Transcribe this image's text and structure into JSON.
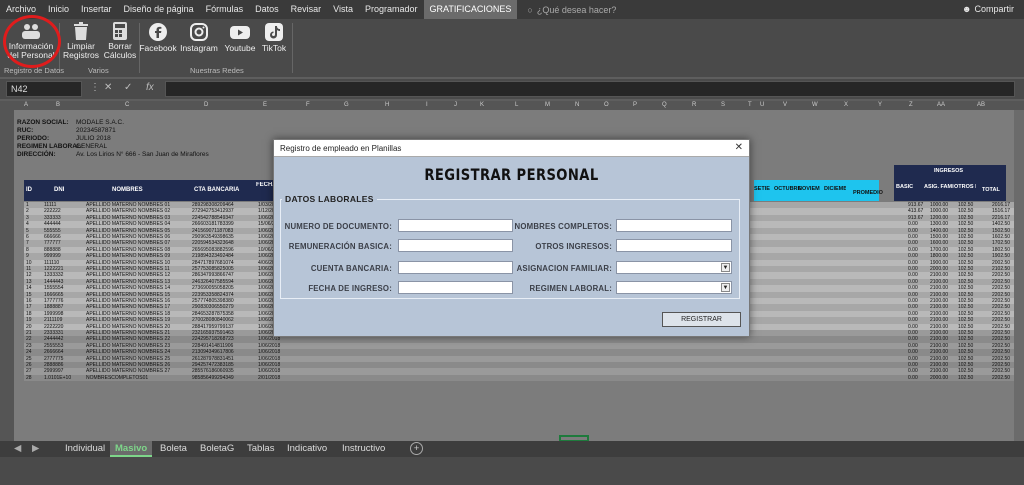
{
  "menu": {
    "tabs": [
      "Archivo",
      "Inicio",
      "Insertar",
      "Diseño de página",
      "Fórmulas",
      "Datos",
      "Revisar",
      "Vista",
      "Programador",
      "GRATIFICACIONES"
    ],
    "tell_me": "¿Qué desea hacer?",
    "share": "Compartir"
  },
  "ribbon": {
    "info_label": "Información del Personal",
    "clear_label": "Limpiar Registros",
    "delete_label": "Borrar Cálculos",
    "facebook": "Facebook",
    "instagram": "Instagram",
    "youtube": "Youtube",
    "tiktok": "TikTok",
    "group_data": "Registro de Datos",
    "group_misc": "Varios",
    "group_social": "Nuestras Redes"
  },
  "formula_bar": {
    "name_box": "N42",
    "fx": "fx",
    "content": ""
  },
  "sheet_info": {
    "labels": [
      "RAZON SOCIAL:",
      "RUC:",
      "PERIODO:",
      "REGIMEN LABORAL:",
      "DIRECCIÓN:"
    ],
    "values": [
      "MODALE S.A.C.",
      "20234587871",
      "JULIO 2018",
      "GENERAL",
      "Av. Los Lirios N° 666 - San Juan de Miraflores"
    ]
  },
  "table": {
    "headers": [
      "ID",
      "DNI",
      "NOMBRES",
      "CTA BANCARIA",
      "FECHA DE INGRESO"
    ],
    "right_headers": [
      "SETIEMBRE",
      "OCTUBRE",
      "NOVIEMBRE",
      "DICIEMBRE",
      "PROMEDIO",
      "BASIC",
      "ASIG. FAMI",
      "OTROS ING.",
      "TOTAL"
    ],
    "ingresos": "INGRESOS",
    "rows": [
      [
        "1",
        "11111",
        "APELLIDO MATERNO NOMBRES 01",
        "289298308209464",
        "1/03/2019",
        "913.67",
        "1000.00",
        "102.50",
        "2016.17"
      ],
      [
        "2",
        "222222",
        "APELLIDO MATERNO NOMBRES 02",
        "272942753412937",
        "1/12/2018",
        "413.67",
        "1000.00",
        "102.50",
        "1516.17"
      ],
      [
        "3",
        "333333",
        "APELLIDO MATERNO NOMBRES 03",
        "224542788549347",
        "1/06/2018",
        "913.67",
        "1200.00",
        "102.50",
        "2216.17"
      ],
      [
        "4",
        "444444",
        "APELLIDO MATERNO NOMBRES 04",
        "266603181783399",
        "15/06/2018",
        "0.00",
        "1300.00",
        "102.50",
        "1402.50"
      ],
      [
        "5",
        "555555",
        "APELLIDO MATERNO NOMBRES 05",
        "241569071187083",
        "1/06/2018",
        "0.00",
        "1400.00",
        "102.50",
        "1502.50"
      ],
      [
        "6",
        "666666",
        "APELLIDO MATERNO NOMBRES 06",
        "290963549398635",
        "1/06/2018",
        "0.00",
        "1500.00",
        "102.50",
        "1602.50"
      ],
      [
        "7",
        "777777",
        "APELLIDO MATERNO NOMBRES 07",
        "220594534323648",
        "1/06/2018",
        "0.00",
        "1600.00",
        "102.50",
        "1702.50"
      ],
      [
        "8",
        "888888",
        "APELLIDO MATERNO NOMBRES 08",
        "265695083882596",
        "10/06/2018",
        "0.00",
        "1700.00",
        "102.50",
        "1802.50"
      ],
      [
        "9",
        "999999",
        "APELLIDO MATERNO NOMBRES 09",
        "219894323492484",
        "1/06/2018",
        "0.00",
        "1800.00",
        "102.50",
        "1902.50"
      ],
      [
        "10",
        "111110",
        "APELLIDO MATERNO NOMBRES 10",
        "284717897681074",
        "4/06/2018",
        "0.00",
        "1900.00",
        "102.50",
        "2002.50"
      ],
      [
        "11",
        "1222221",
        "APELLIDO MATERNO NOMBRES 11",
        "257753085825005",
        "1/06/2018",
        "0.00",
        "2000.00",
        "102.50",
        "2102.50"
      ],
      [
        "12",
        "1333332",
        "APELLIDO MATERNO NOMBRES 12",
        "286347993866747",
        "1/06/2018",
        "0.00",
        "2100.00",
        "102.50",
        "2202.50"
      ],
      [
        "13",
        "1444443",
        "APELLIDO MATERNO NOMBRES 13",
        "246326407585594",
        "1/06/2018",
        "0.00",
        "2100.00",
        "102.50",
        "2202.50"
      ],
      [
        "14",
        "1555554",
        "APELLIDO MATERNO NOMBRES 14",
        "273690055058205",
        "1/06/2018",
        "0.00",
        "2100.00",
        "102.50",
        "2202.50"
      ],
      [
        "15",
        "1666665",
        "APELLIDO MATERNO NOMBRES 15",
        "223953358824374",
        "1/06/2018",
        "0.00",
        "2100.00",
        "102.50",
        "2202.50"
      ],
      [
        "16",
        "1777776",
        "APELLIDO MATERNO NOMBRES 16",
        "257774805398380",
        "1/06/2018",
        "0.00",
        "2100.00",
        "102.50",
        "2202.50"
      ],
      [
        "17",
        "1888887",
        "APELLIDO MATERNO NOMBRES 17",
        "290830306550279",
        "1/06/2018",
        "0.00",
        "2100.00",
        "102.50",
        "2202.50"
      ],
      [
        "18",
        "1999998",
        "APELLIDO MATERNO NOMBRES 18",
        "284653287875358",
        "1/06/2018",
        "0.00",
        "2100.00",
        "102.50",
        "2202.50"
      ],
      [
        "19",
        "2111109",
        "APELLIDO MATERNO NOMBRES 19",
        "270028080840062",
        "1/06/2018",
        "0.00",
        "2100.00",
        "102.50",
        "2202.50"
      ],
      [
        "20",
        "2222220",
        "APELLIDO MATERNO NOMBRES 20",
        "288417959799137",
        "1/06/2018",
        "0.00",
        "2100.00",
        "102.50",
        "2202.50"
      ],
      [
        "21",
        "2333331",
        "APELLIDO MATERNO NOMBRES 21",
        "232165937591463",
        "1/06/2018",
        "0.00",
        "2100.00",
        "102.50",
        "2202.50"
      ],
      [
        "22",
        "2444442",
        "APELLIDO MATERNO NOMBRES 22",
        "224295718268723",
        "1/06/2018",
        "0.00",
        "2100.00",
        "102.50",
        "2202.50"
      ],
      [
        "23",
        "2555553",
        "APELLIDO MATERNO NOMBRES 23",
        "228491414811906",
        "1/06/2018",
        "0.00",
        "2100.00",
        "102.50",
        "2202.50"
      ],
      [
        "24",
        "2666664",
        "APELLIDO MATERNO NOMBRES 24",
        "213094349617806",
        "1/06/2018",
        "0.00",
        "2100.00",
        "102.50",
        "2202.50"
      ],
      [
        "25",
        "2777775",
        "APELLIDO MATERNO NOMBRES 25",
        "261287978831451",
        "1/06/2018",
        "0.00",
        "2100.00",
        "102.50",
        "2202.50"
      ],
      [
        "26",
        "2888886",
        "APELLIDO MATERNO NOMBRES 26",
        "294257472383185",
        "1/06/2018",
        "0.00",
        "2100.00",
        "102.50",
        "2202.50"
      ],
      [
        "27",
        "2999997",
        "APELLIDO MATERNO NOMBRES 27",
        "285576186060935",
        "1/06/2018",
        "0.00",
        "2100.00",
        "102.50",
        "2202.50"
      ],
      [
        "28",
        "1.0101E+10",
        "NOMBRESCOMPLETOS01",
        "985856499294349",
        "2/01/2018",
        "0.00",
        "2000.00",
        "102.50",
        "2202.50"
      ]
    ]
  },
  "dialog": {
    "title": "Registro de empleado en Planillas",
    "heading": "REGISTRAR PERSONAL",
    "section": "DATOS LABORALES",
    "fields_left": [
      "NUMERO DE DOCUMENTO:",
      "REMUNERACIÓN BASICA:",
      "CUENTA BANCARIA:",
      "FECHA DE INGRESO:"
    ],
    "fields_right": [
      "NOMBRES COMPLETOS:",
      "OTROS INGRESOS:",
      "ASIGNACION FAMILIAR:",
      "REGIMEN LABORAL:"
    ],
    "button": "REGISTRAR"
  },
  "sheet_tabs": [
    "Individual",
    "Masivo",
    "Boleta",
    "BoletaG",
    "Tablas",
    "Indicativo",
    "Instructivo"
  ],
  "active_tab": "Masivo",
  "colors": {
    "accent_green": "#7ed68a",
    "header_navy": "#1f2a4f",
    "header_cyan": "#1ec4ee",
    "annotation_red": "#e01c1c"
  }
}
